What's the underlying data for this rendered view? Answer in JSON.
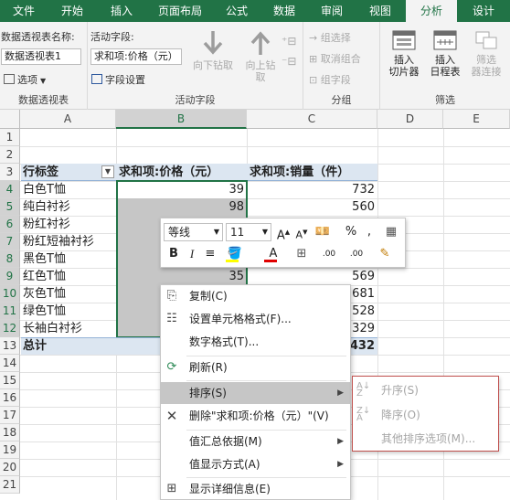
{
  "ribbon_tabs": [
    "文件",
    "开始",
    "插入",
    "页面布局",
    "公式",
    "数据",
    "审阅",
    "视图",
    "分析",
    "设计"
  ],
  "active_tab_index": 8,
  "colors": {
    "accent": "#217346",
    "selection_gray": "#c6c6c6",
    "header_fill": "#dce6f1",
    "submenu_border": "#c0504d"
  },
  "ribbon": {
    "pivot_name_label": "数据透视表名称:",
    "pivot_name_value": "数据透视表1",
    "options_label": "选项",
    "group_pivot": "数据透视表",
    "active_field_label": "活动字段:",
    "active_field_value": "求和项:价格（元）",
    "field_settings": "字段设置",
    "drill_down": [
      "向下钻取"
    ],
    "drill_up": [
      "向上钻",
      "取"
    ],
    "group_active": "活动字段",
    "group_selection": "组选择",
    "ungroup": "取消组合",
    "group_field": "组字段",
    "group_group": "分组",
    "slicer": [
      "插入",
      "切片器"
    ],
    "timeline": [
      "插入",
      "日程表"
    ],
    "filter_conn": [
      "筛选",
      "器连接"
    ],
    "group_filter": "筛选"
  },
  "columns": [
    "A",
    "B",
    "C",
    "D",
    "E"
  ],
  "rows": [
    "1",
    "2",
    "3",
    "4",
    "5",
    "6",
    "7",
    "8",
    "9",
    "10",
    "11",
    "12",
    "13",
    "14",
    "15",
    "16",
    "17",
    "18",
    "19",
    "20",
    "21"
  ],
  "pivot": {
    "header_label": "行标签",
    "header_price": "求和项:价格（元）",
    "header_qty": "求和项:销量（件）",
    "labels": [
      "白色T恤",
      "纯白衬衫",
      "粉红衬衫",
      "粉红短袖衬衫",
      "黑色T恤",
      "红色T恤",
      "灰色T恤",
      "绿色T恤",
      "长袖白衬衫"
    ],
    "price_visible": [
      "39",
      "98",
      "",
      "",
      "",
      "35",
      "",
      "",
      ""
    ],
    "qty_visible": [
      "732",
      "560",
      "",
      "",
      "",
      "569",
      "681",
      "528",
      "329"
    ],
    "total_label": "总计",
    "total_qty": "432"
  },
  "mini_toolbar": {
    "font": "等线",
    "size": "11",
    "grow": "A",
    "shrink": "A",
    "percent": "%",
    "comma": ",",
    "bold": "B",
    "italic": "I",
    "dec_inc": ".00",
    "dec_dec": ".00"
  },
  "context_menu": [
    {
      "label": "复制(C)",
      "icon": "copy-icon",
      "glyph": "⎘",
      "submenu": false
    },
    {
      "label": "设置单元格格式(F)...",
      "icon": "format-cells-icon",
      "glyph": "☷",
      "submenu": false
    },
    {
      "label": "数字格式(T)...",
      "icon": "",
      "glyph": "",
      "submenu": false
    },
    {
      "label": "刷新(R)",
      "icon": "refresh-icon",
      "glyph": "⟳",
      "submenu": false
    },
    {
      "label": "排序(S)",
      "icon": "",
      "glyph": "",
      "submenu": true,
      "hover": true
    },
    {
      "label": "删除\"求和项:价格（元）\"(V)",
      "icon": "delete-icon",
      "glyph": "✕",
      "submenu": false
    },
    {
      "label": "值汇总依据(M)",
      "icon": "",
      "glyph": "",
      "submenu": true
    },
    {
      "label": "值显示方式(A)",
      "icon": "",
      "glyph": "",
      "submenu": true
    },
    {
      "label": "显示详细信息(E)",
      "icon": "show-details-icon",
      "glyph": "⊞",
      "submenu": false
    }
  ],
  "sort_submenu": [
    {
      "label": "升序(S)",
      "icon": "sort-ascending-icon"
    },
    {
      "label": "降序(O)",
      "icon": "sort-descending-icon"
    },
    {
      "label": "其他排序选项(M)...",
      "icon": ""
    }
  ]
}
